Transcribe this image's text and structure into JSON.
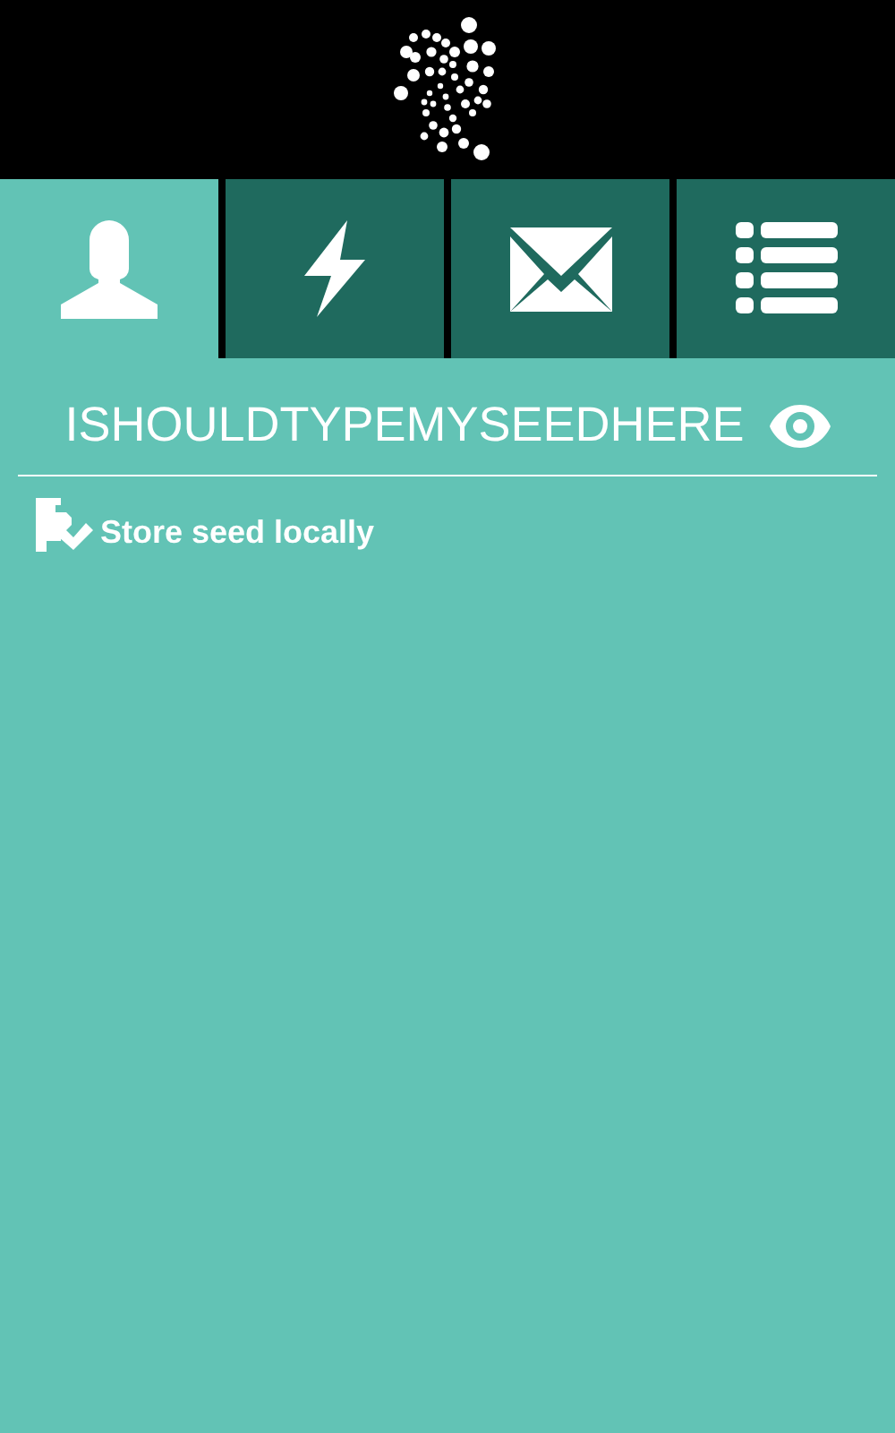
{
  "tabs": [
    {
      "kind": "account",
      "selected": true
    },
    {
      "kind": "transfer",
      "selected": false
    },
    {
      "kind": "messages",
      "selected": false
    },
    {
      "kind": "history",
      "selected": false
    }
  ],
  "seed_field": {
    "value": "ISHOULDTYPEMYSEEDHERE"
  },
  "store_option": {
    "label": "Store seed locally"
  }
}
